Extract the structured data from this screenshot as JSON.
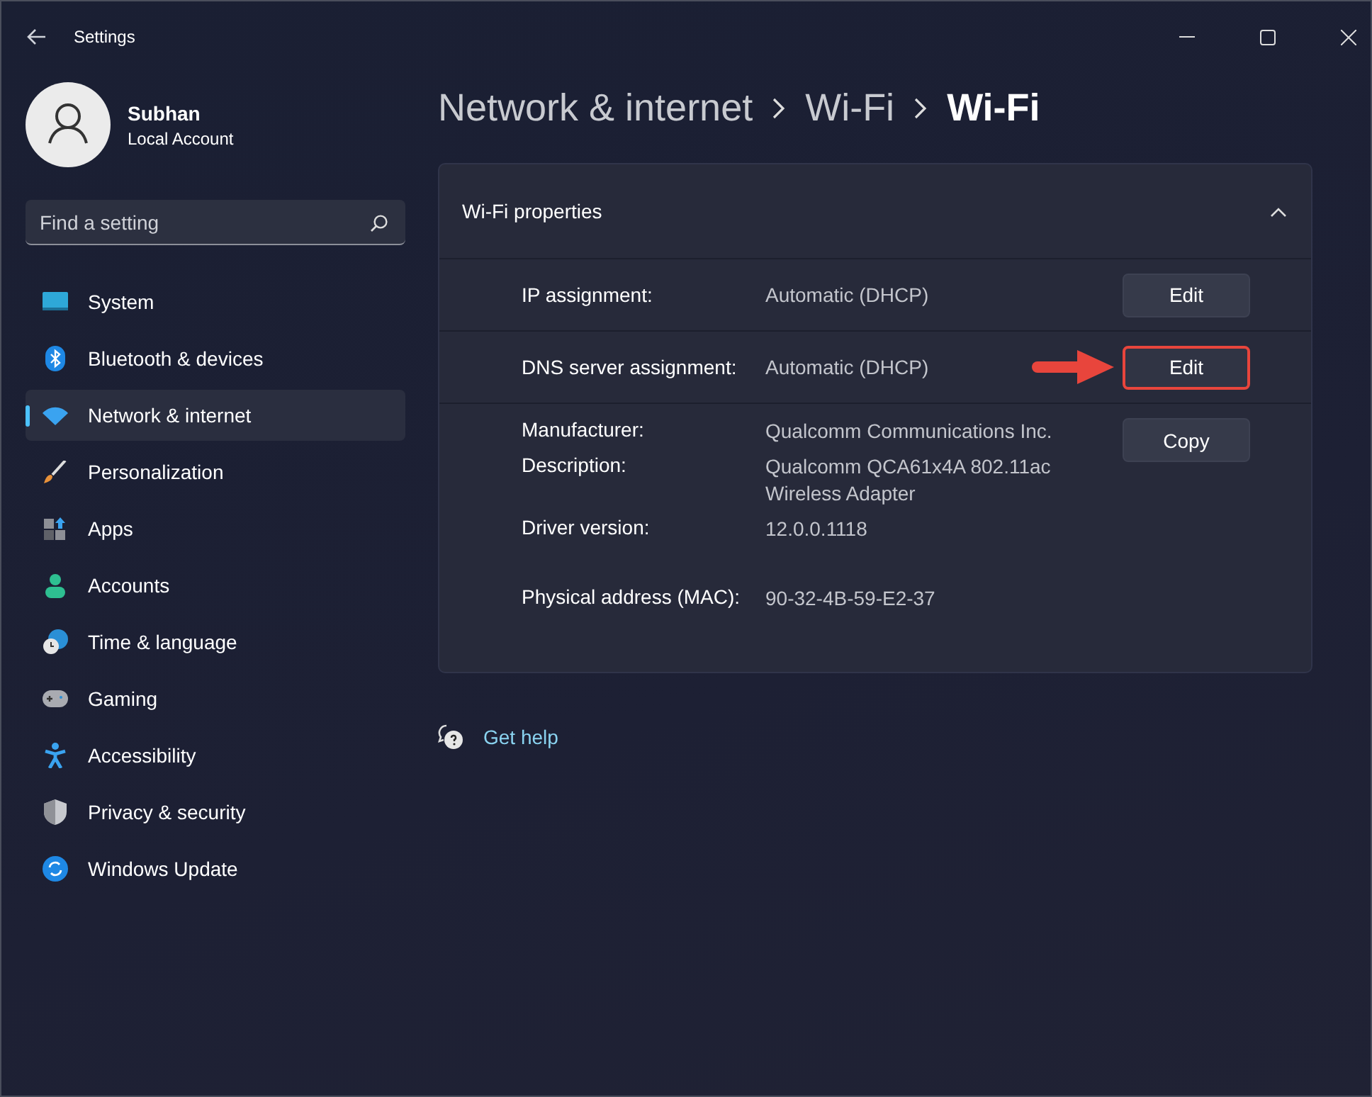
{
  "window": {
    "title": "Settings"
  },
  "account": {
    "name": "Subhan",
    "type": "Local Account"
  },
  "search": {
    "placeholder": "Find a setting"
  },
  "sidebar": {
    "items": [
      {
        "label": "System",
        "selected": false
      },
      {
        "label": "Bluetooth & devices",
        "selected": false
      },
      {
        "label": "Network & internet",
        "selected": true
      },
      {
        "label": "Personalization",
        "selected": false
      },
      {
        "label": "Apps",
        "selected": false
      },
      {
        "label": "Accounts",
        "selected": false
      },
      {
        "label": "Time & language",
        "selected": false
      },
      {
        "label": "Gaming",
        "selected": false
      },
      {
        "label": "Accessibility",
        "selected": false
      },
      {
        "label": "Privacy & security",
        "selected": false
      },
      {
        "label": "Windows Update",
        "selected": false
      }
    ]
  },
  "breadcrumb": [
    "Network & internet",
    "Wi-Fi",
    "Wi-Fi"
  ],
  "card": {
    "title": "Wi-Fi properties",
    "expanded": true,
    "rows": [
      {
        "label": "IP assignment:",
        "value": "Automatic (DHCP)",
        "button": "Edit",
        "highlighted": false
      },
      {
        "label": "DNS server assignment:",
        "value": "Automatic (DHCP)",
        "button": "Edit",
        "highlighted": true
      }
    ],
    "details": [
      {
        "label": "Manufacturer:",
        "value": "Qualcomm Communications Inc."
      },
      {
        "label": "Description:",
        "value": "Qualcomm QCA61x4A 802.11ac\nWireless Adapter"
      },
      {
        "label": "Driver version:",
        "value": "12.0.0.1118"
      },
      {
        "label": "Physical address (MAC):",
        "value": "90-32-4B-59-E2-37"
      }
    ],
    "copy_button": "Copy"
  },
  "help_link": "Get help"
}
